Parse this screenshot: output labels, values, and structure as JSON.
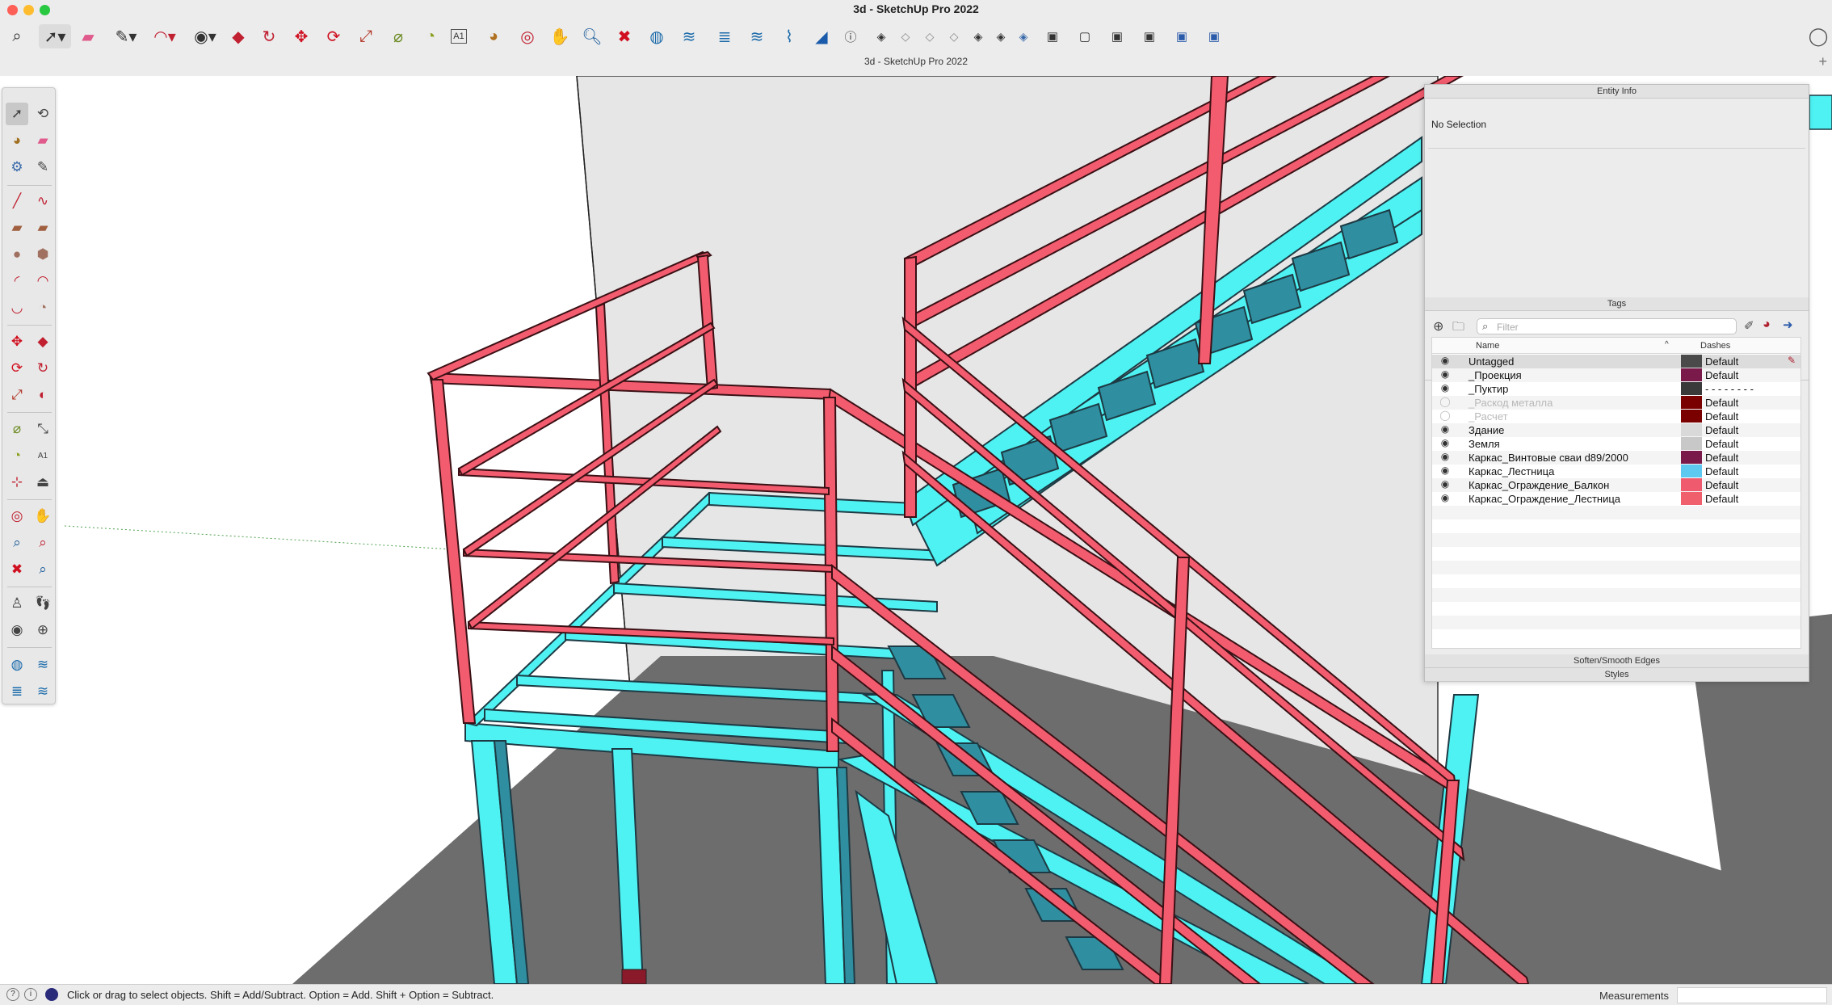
{
  "window": {
    "title": "3d - SketchUp Pro 2022",
    "document_title": "3d - SketchUp Pro 2022"
  },
  "toolbar": {
    "icons": [
      "search-icon",
      "select-icon",
      "eraser-icon",
      "pencil-icon",
      "arc-icon",
      "circle-icon",
      "push-pull-icon",
      "follow-me-icon",
      "move-icon",
      "rotate-icon",
      "scale-icon",
      "tape-measure-icon",
      "protractor-icon",
      "text-icon",
      "paint-bucket-icon",
      "orbit-icon",
      "pan-icon",
      "zoom-icon",
      "zoom-extents-icon",
      "outliner-icon",
      "tags-icon",
      "layers-icon",
      "solid-tools-icon",
      "sandbox-icon",
      "measure-icon",
      "info-icon",
      "iso-view-icon",
      "top-view-icon",
      "front-view-icon",
      "right-view-icon",
      "back-view-icon",
      "left-view-icon",
      "bottom-view-icon",
      "xray-style-icon",
      "wireframe-style-icon",
      "hidden-line-style-icon",
      "shaded-style-icon",
      "textured-style-icon",
      "monochrome-style-icon",
      "account-icon"
    ]
  },
  "palette": {
    "tools": [
      "select",
      "lasso",
      "paint",
      "eraser",
      "tags",
      "pencil",
      "line",
      "freehand",
      "rectangle",
      "rotated-rectangle",
      "circle",
      "polygon",
      "arc",
      "2pt-arc",
      "3pt-arc",
      "pie",
      "move",
      "push-pull",
      "rotate",
      "follow-me",
      "scale",
      "offset",
      "tape",
      "dimension",
      "protractor",
      "text",
      "axes",
      "section",
      "orbit",
      "pan",
      "zoom",
      "zoom-window",
      "zoom-extents",
      "previous",
      "position-camera",
      "walk",
      "look-around",
      "section-plane",
      "outliner",
      "scenes",
      "layers",
      "sandbox"
    ]
  },
  "tray": {
    "entity_info_title": "Entity Info",
    "no_selection": "No Selection",
    "tags_title": "Tags",
    "filter_placeholder": "Filter",
    "col_name": "Name",
    "col_dashes": "Dashes",
    "soften_title": "Soften/Smooth Edges",
    "styles_title": "Styles"
  },
  "tags": [
    {
      "name": "Untagged",
      "visible": true,
      "color": "#4a4a4a",
      "dashes": "Default",
      "active": true
    },
    {
      "name": "_Проекция",
      "visible": true,
      "color": "#7a1a4a",
      "dashes": "Default"
    },
    {
      "name": "_Пуктир",
      "visible": true,
      "color": "#3a3a3a",
      "dashes": "- - - - - - - -"
    },
    {
      "name": "_Раскод металла",
      "visible": false,
      "color": "#7a0000",
      "dashes": "Default"
    },
    {
      "name": "_Расчет",
      "visible": false,
      "color": "#7a0000",
      "dashes": "Default"
    },
    {
      "name": "Здание",
      "visible": true,
      "color": "#d9d9d9",
      "dashes": "Default"
    },
    {
      "name": "Земля",
      "visible": true,
      "color": "#c8c8c8",
      "dashes": "Default"
    },
    {
      "name": "Каркас_Винтовые сваи d89/2000",
      "visible": true,
      "color": "#7a1a4a",
      "dashes": "Default"
    },
    {
      "name": "Каркас_Лестница",
      "visible": true,
      "color": "#5ec9f0",
      "dashes": "Default"
    },
    {
      "name": "Каркас_Ограждение_Балкон",
      "visible": true,
      "color": "#f05a6e",
      "dashes": "Default"
    },
    {
      "name": "Каркас_Ограждение_Лестница",
      "visible": true,
      "color": "#f0606c",
      "dashes": "Default"
    }
  ],
  "status": {
    "hint": "Click or drag to select objects. Shift = Add/Subtract. Option = Add. Shift + Option = Subtract.",
    "measurements_label": "Measurements",
    "measurements_value": ""
  },
  "colors": {
    "railing": "#f25c6e",
    "railing_edge": "#6b1f28",
    "frame": "#4ef2f2",
    "frame_dark": "#2f8fa0",
    "ground": "#6f6f6f",
    "wall": "#e8e8e8"
  }
}
